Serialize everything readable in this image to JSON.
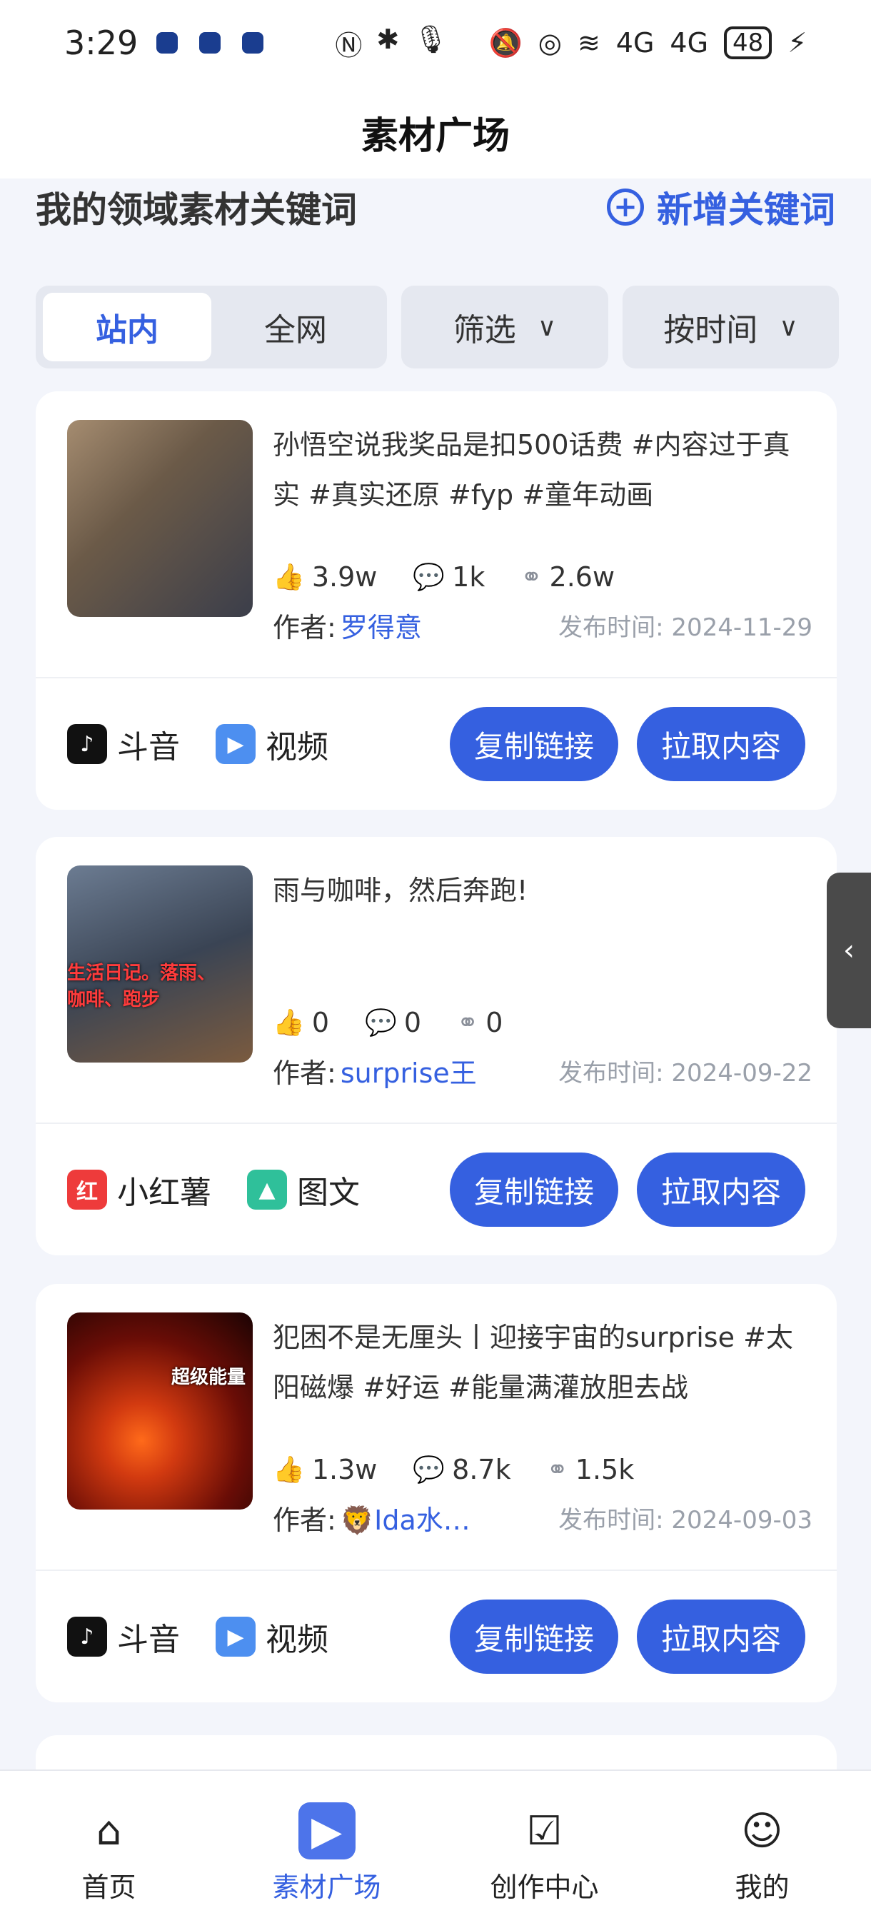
{
  "status": {
    "time": "3:29",
    "battery": "48",
    "network": "4G"
  },
  "header": {
    "title": "素材广场"
  },
  "keywords": {
    "title": "我的领域素材关键词",
    "add_label": "新增关键词"
  },
  "filters": {
    "segments": [
      "站内",
      "全网"
    ],
    "active_segment": "站内",
    "filter_label": "筛选",
    "sort_label": "按时间"
  },
  "cards": [
    {
      "text": "孙悟空说我奖品是扣500话费 #内容过于真实 #真实还原 #fyp #童年动画",
      "likes": "3.9w",
      "comments": "1k",
      "shares": "2.6w",
      "author_label": "作者:",
      "author": "罗得意",
      "publish": "发布时间: 2024-11-29",
      "platform": "斗音",
      "content_type": "视频",
      "copy_btn": "复制链接",
      "pull_btn": "拉取内容"
    },
    {
      "text": "雨与咖啡，然后奔跑!",
      "likes": "0",
      "comments": "0",
      "shares": "0",
      "author_label": "作者:",
      "author": "surprise王",
      "publish": "发布时间: 2024-09-22",
      "platform": "小红薯",
      "content_type": "图文",
      "copy_btn": "复制链接",
      "pull_btn": "拉取内容",
      "thumb_caption": "生活日记。落雨、咖啡、跑步"
    },
    {
      "text": "犯困不是无厘头丨迎接宇宙的surprise #太阳磁爆 #好运 #能量满灌放胆去战",
      "likes": "1.3w",
      "comments": "8.7k",
      "shares": "1.5k",
      "author_label": "作者:",
      "author": "🦁Ida水…",
      "publish": "发布时间: 2024-09-03",
      "platform": "斗音",
      "content_type": "视频",
      "copy_btn": "复制链接",
      "pull_btn": "拉取内容",
      "thumb_caption": "超级能量"
    }
  ],
  "tabbar": {
    "items": [
      {
        "label": "首页",
        "icon": "home-icon"
      },
      {
        "label": "素材广场",
        "icon": "material-icon"
      },
      {
        "label": "创作中心",
        "icon": "create-icon"
      },
      {
        "label": "我的",
        "icon": "profile-icon"
      }
    ],
    "active": "素材广场"
  },
  "colors": {
    "accent": "#3560e0",
    "background": "#f3f5fb",
    "douyin": "#111111",
    "xiaohongshu": "#ee3b3b"
  }
}
